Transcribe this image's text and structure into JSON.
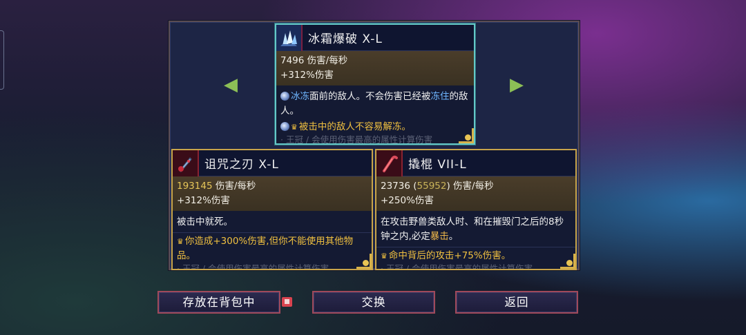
{
  "navigation": {
    "prev_arrow": "◀",
    "next_arrow": "▶"
  },
  "cards": {
    "top": {
      "title": "冰霜爆破  X-L",
      "icon": "ice-crystal-icon",
      "stat_dps": "7496 伤害/每秒",
      "stat_bonus": "+312%伤害",
      "desc_part1": "冰冻",
      "desc_part2": "面前的敌人。不会伤害已经被",
      "desc_part3": "冻住",
      "desc_part4": "的敌人。",
      "perk": "被击中的敌人不容易解冻。",
      "faded": "· 王冠 / 会使用伤害最高的属性计算伤害"
    },
    "left": {
      "title": "诅咒之刃  X-L",
      "icon": "cursed-sword-icon",
      "stat_value": "193145",
      "stat_unit": " 伤害/每秒",
      "stat_bonus": "+312%伤害",
      "desc": "被击中就死。",
      "perk": "你造成+300%伤害,但你不能使用其他物品。",
      "faded": "· 王冠 / 会使用伤害最高的属性计算伤害"
    },
    "right": {
      "title": "撬棍  VII-L",
      "icon": "crowbar-icon",
      "stat_value": "23736",
      "stat_paren_open": " (",
      "stat_paren_value": "55952",
      "stat_paren_close": ") ",
      "stat_unit": "伤害/每秒",
      "stat_bonus": "+250%伤害",
      "desc_part1": "在攻击野兽类敌人时、和在摧毁门之后的8秒钟之内,必定",
      "desc_part2": "暴击",
      "desc_part3": "。",
      "perk": "命中背后的攻击+75%伤害。",
      "faded": "· 王冠 / 会使用伤害最高的属性计算伤害"
    }
  },
  "buttons": {
    "store": "存放在背包中",
    "swap": "交换",
    "back": "返回"
  },
  "colors": {
    "gold_border": "#c9a54a",
    "selected_border": "#64c8c8",
    "perk_text": "#f0c040",
    "frozen_text": "#6fb6ff",
    "crit_text": "#f0b84a"
  }
}
